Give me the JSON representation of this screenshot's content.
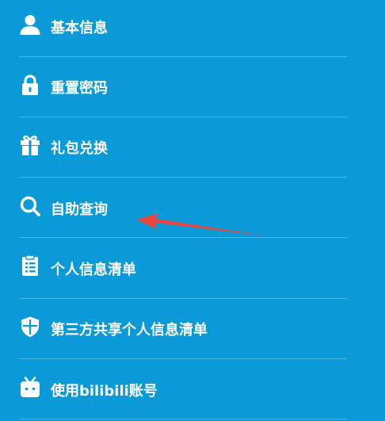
{
  "menu": {
    "items": [
      {
        "label": "基本信息",
        "icon": "user-icon"
      },
      {
        "label": "重置密码",
        "icon": "lock-icon"
      },
      {
        "label": "礼包兑换",
        "icon": "gift-icon"
      },
      {
        "label": "自助查询",
        "icon": "search-icon"
      },
      {
        "label": "个人信息清单",
        "icon": "clipboard-list-icon"
      },
      {
        "label": "第三方共享个人信息清单",
        "icon": "shield-icon"
      },
      {
        "label": "使用bilibili账号",
        "icon": "bilibili-tv-icon"
      }
    ]
  },
  "colors": {
    "background": "#0b9ad8",
    "text": "#ffffff",
    "divider": "#4bb6e6",
    "annotation_arrow": "#e8453c"
  },
  "annotation": {
    "icon": "red-arrow-icon"
  }
}
